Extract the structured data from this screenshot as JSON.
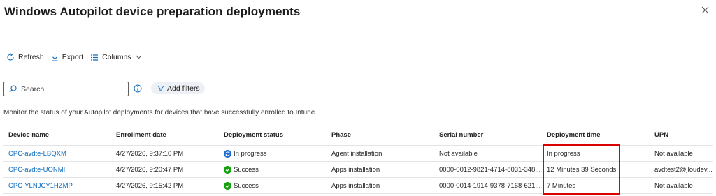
{
  "header": {
    "title": "Windows Autopilot device preparation deployments",
    "more_label": "...",
    "close_icon": "close-icon"
  },
  "toolbar": {
    "refresh_label": "Refresh",
    "export_label": "Export",
    "columns_label": "Columns"
  },
  "search": {
    "placeholder": "Search"
  },
  "filters": {
    "add_label": "Add filters"
  },
  "description": "Monitor the status of your Autopilot deployments for devices that have successfully enrolled to Intune.",
  "table": {
    "columns": [
      "Device name",
      "Enrollment date",
      "Deployment status",
      "Phase",
      "Serial number",
      "Deployment time",
      "UPN"
    ],
    "rows": [
      {
        "device_name": "CPC-avdte-LBQXM",
        "enrollment_date": "4/27/2026, 9:37:10 PM",
        "status": "In progress",
        "status_icon": "in-progress-icon",
        "phase": "Agent installation",
        "serial": "Not available",
        "deployment_time": "In progress",
        "upn": "Not available"
      },
      {
        "device_name": "CPC-avdte-UONMI",
        "enrollment_date": "4/27/2026, 9:20:47 PM",
        "status": "Success",
        "status_icon": "success-check-icon",
        "phase": "Apps installation",
        "serial": "0000-0012-9821-4714-8031-348...",
        "deployment_time": "12 Minutes 39 Seconds",
        "upn": "avdtest2@jloudev..."
      },
      {
        "device_name": "CPC-YLNJCY1HZMP",
        "enrollment_date": "4/27/2026, 9:15:42 PM",
        "status": "Success",
        "status_icon": "success-check-icon",
        "phase": "Apps installation",
        "serial": "0000-0014-1914-9378-7168-621...",
        "deployment_time": "7 Minutes",
        "upn": "Not available"
      }
    ]
  },
  "colors": {
    "link": "#0f6cbd",
    "success": "#13a10e",
    "in_progress": "#1f6fd1",
    "highlight": "#d90000"
  }
}
